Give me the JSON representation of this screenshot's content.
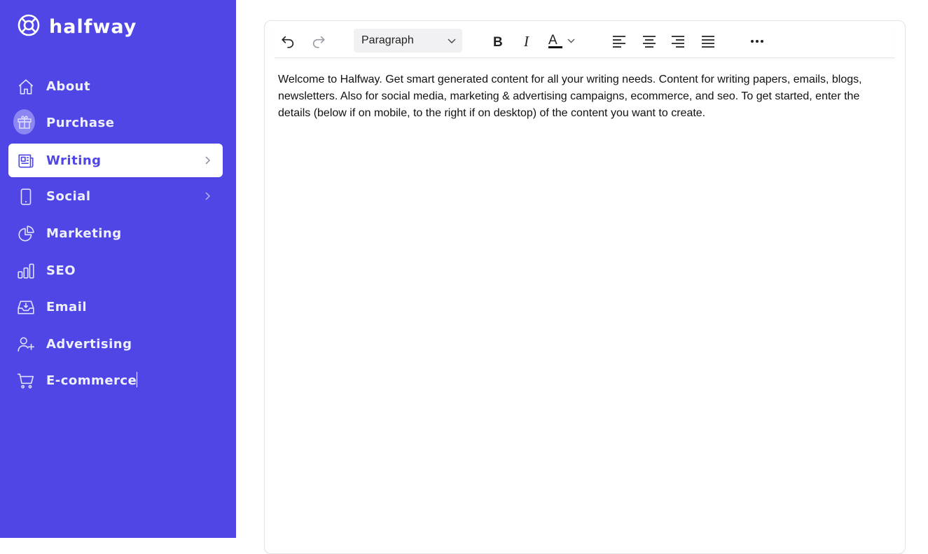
{
  "brand": {
    "name": "halfway",
    "logo_icon": "lifebuoy-icon"
  },
  "sidebar": {
    "background": "#4f46e5",
    "items": [
      {
        "label": "About",
        "icon": "home-icon",
        "active": false,
        "has_chevron": false
      },
      {
        "label": "Purchase",
        "icon": "gift-icon",
        "active": false,
        "has_chevron": false
      },
      {
        "label": "Writing",
        "icon": "newspaper-icon",
        "active": true,
        "has_chevron": true
      },
      {
        "label": "Social",
        "icon": "phone-icon",
        "active": false,
        "has_chevron": true
      },
      {
        "label": "Marketing",
        "icon": "pie-chart-icon",
        "active": false,
        "has_chevron": false
      },
      {
        "label": "SEO",
        "icon": "bar-chart-icon",
        "active": false,
        "has_chevron": false
      },
      {
        "label": "Email",
        "icon": "inbox-icon",
        "active": false,
        "has_chevron": false
      },
      {
        "label": "Advertising",
        "icon": "user-add-icon",
        "active": false,
        "has_chevron": false
      },
      {
        "label": "E-commerce",
        "icon": "cart-icon",
        "active": false,
        "has_chevron": false
      }
    ]
  },
  "editor": {
    "toolbar": {
      "block_format": "Paragraph",
      "buttons": [
        "undo-icon",
        "redo-icon",
        "bold-icon",
        "italic-icon",
        "text-color-icon",
        "align-left-icon",
        "align-center-icon",
        "align-right-icon",
        "align-justify-icon",
        "more-icon"
      ]
    },
    "content": "Welcome to Halfway. Get smart generated content for all your writing needs. Content for writing papers, emails, blogs, newsletters. Also for social media, marketing & advertising campaigns, ecommerce, and seo. To get started, enter the details (below if on mobile, to the right if on desktop) of the content you want to create."
  }
}
